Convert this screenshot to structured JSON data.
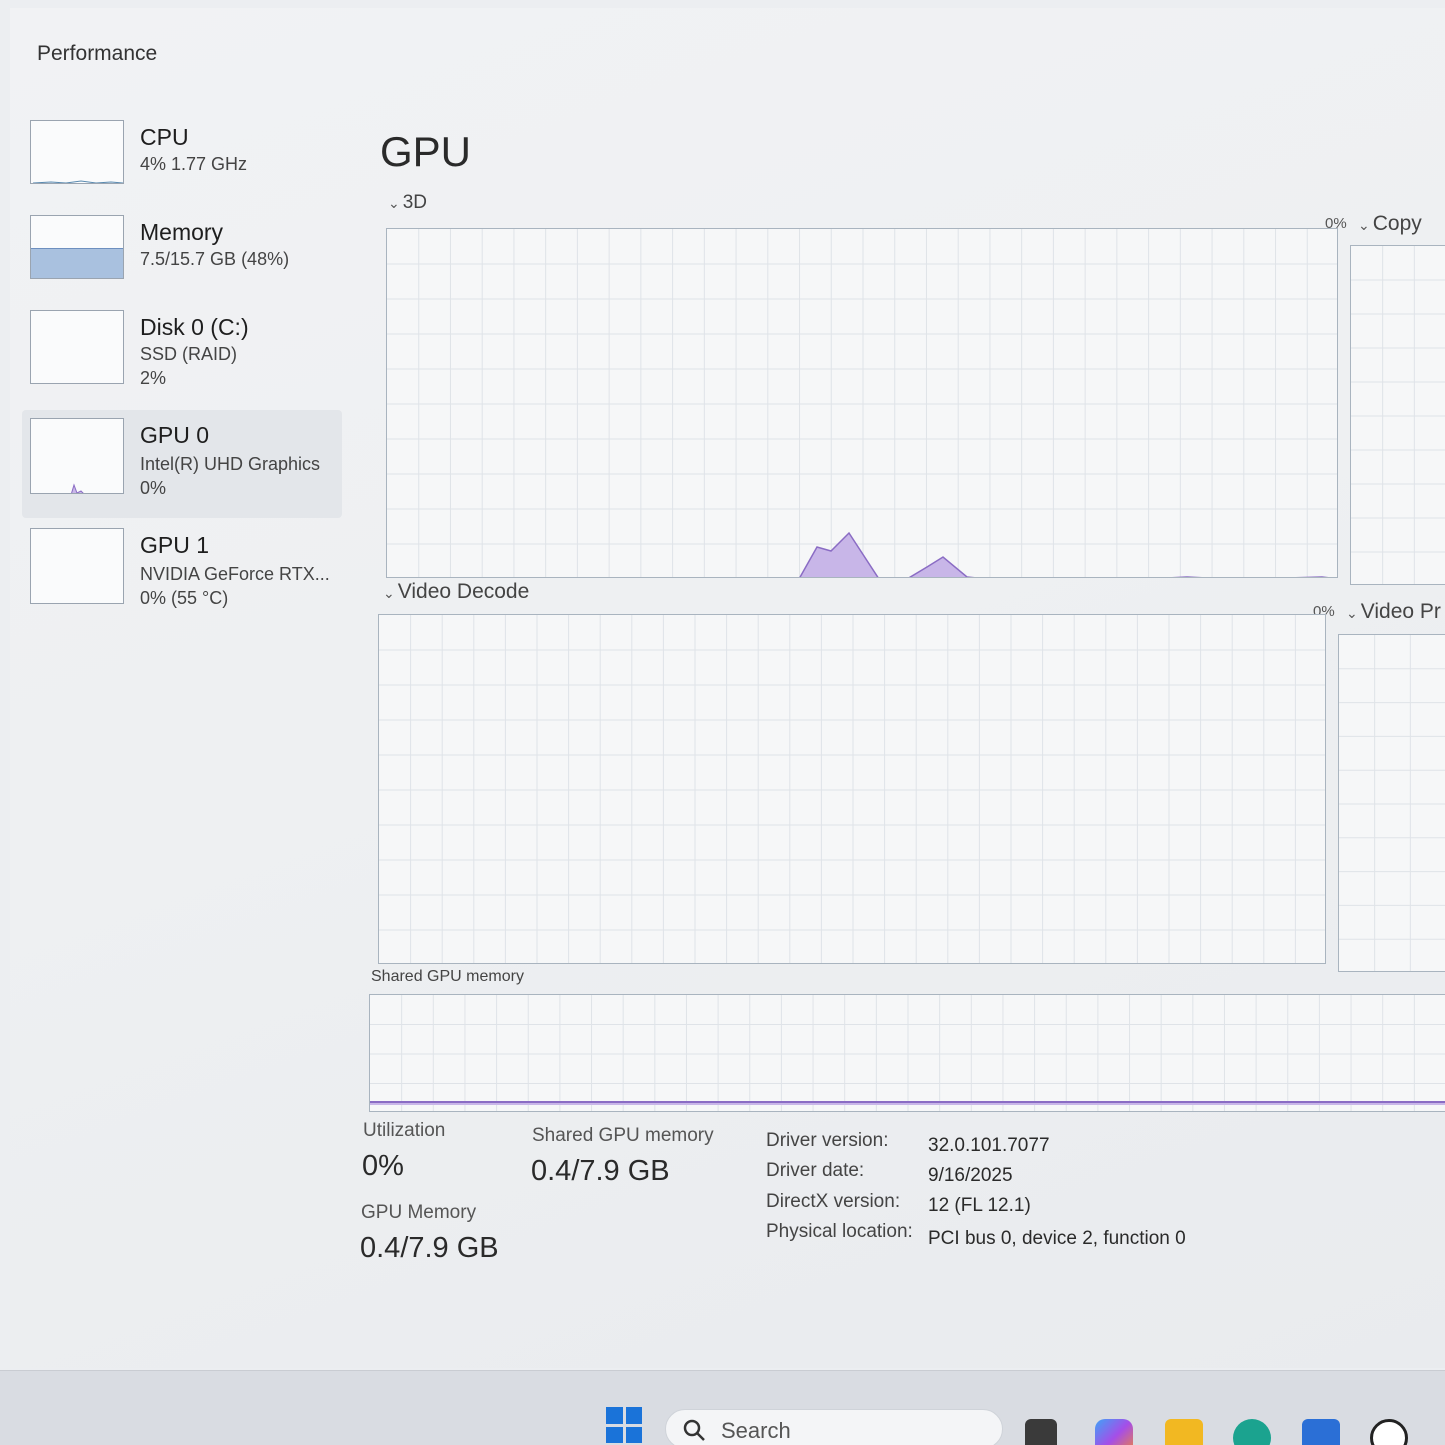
{
  "window": {
    "title": "Performance"
  },
  "sidebar": {
    "items": [
      {
        "name": "CPU",
        "sub1": "4%  1.77 GHz",
        "sub2": ""
      },
      {
        "name": "Memory",
        "sub1": "7.5/15.7 GB (48%)",
        "sub2": ""
      },
      {
        "name": "Disk 0 (C:)",
        "sub1": "SSD (RAID)",
        "sub2": "2%"
      },
      {
        "name": "GPU 0",
        "sub1": "Intel(R) UHD Graphics",
        "sub2": "0%"
      },
      {
        "name": "GPU 1",
        "sub1": "NVIDIA GeForce RTX...",
        "sub2": "0% (55 °C)"
      }
    ],
    "memory_fill": 0.48
  },
  "main": {
    "title": "GPU",
    "graphs": {
      "g3d": {
        "label": "3D",
        "pct": "0%"
      },
      "copy": {
        "label": "Copy"
      },
      "video_decode": {
        "label": "Video Decode",
        "pct": "0%"
      },
      "video_processing": {
        "label": "Video Pr"
      },
      "shared_memory": {
        "label": "Shared GPU memory"
      }
    },
    "stats": {
      "utilization_label": "Utilization",
      "utilization_value": "0%",
      "shared_label": "Shared GPU memory",
      "shared_value": "0.4/7.9 GB",
      "gpu_mem_label": "GPU Memory",
      "gpu_mem_value": "0.4/7.9 GB"
    },
    "info": [
      {
        "label": "Driver version:",
        "value": "32.0.101.7077"
      },
      {
        "label": "Driver date:",
        "value": "9/16/2025"
      },
      {
        "label": "DirectX version:",
        "value": "12 (FL 12.1)"
      },
      {
        "label": "Physical location:",
        "value": "PCI bus 0, device 2, function 0"
      }
    ]
  },
  "taskbar": {
    "search_label": "Search",
    "icons": [
      "windows-start-icon",
      "task-view-icon",
      "copilot-icon",
      "file-explorer-icon",
      "edge-icon",
      "store-icon",
      "dell-icon"
    ]
  },
  "colors": {
    "gpu_line": "#8a6cc4",
    "gpu_fill": "#c8b6e8",
    "memory_fill": "#a9c1df",
    "grid": "#dfe3e8",
    "accent_windows": "#1a73d9"
  }
}
